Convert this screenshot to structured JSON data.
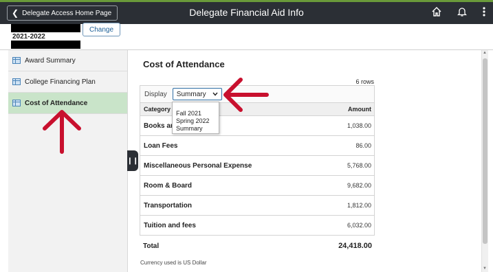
{
  "topbar": {
    "back_label": "Delegate Access Home Page",
    "title": "Delegate Financial Aid Info",
    "icons": [
      "home-icon",
      "bell-icon",
      "more-vertical-icon"
    ]
  },
  "context": {
    "aid_year": "2021-2022",
    "change_label": "Change"
  },
  "sidebar": {
    "items": [
      {
        "label": "Award Summary"
      },
      {
        "label": "College Financing Plan"
      },
      {
        "label": "Cost of Attendance"
      }
    ],
    "active_index": 2
  },
  "main": {
    "title": "Cost of Attendance",
    "rows_count": "6 rows",
    "display_label": "Display",
    "display_value": "Summary",
    "dropdown_options": [
      "Fall 2021",
      "Spring 2022",
      "Summary"
    ],
    "columns": {
      "category": "Category",
      "amount": "Amount"
    },
    "rows": [
      {
        "category": "Books and Supplies",
        "amount": "1,038.00"
      },
      {
        "category": "Loan Fees",
        "amount": "86.00"
      },
      {
        "category": "Miscellaneous Personal Expense",
        "amount": "5,768.00"
      },
      {
        "category": "Room & Board",
        "amount": "9,682.00"
      },
      {
        "category": "Transportation",
        "amount": "1,812.00"
      },
      {
        "category": "Tuition and fees",
        "amount": "6,032.00"
      }
    ],
    "total_label": "Total",
    "total_amount": "24,418.00",
    "currency_note": "Currency used is US Dollar"
  },
  "colors": {
    "topbar": "#2b2f35",
    "active_nav": "#c9e4c9",
    "annotation_arrow": "#c8102e"
  }
}
